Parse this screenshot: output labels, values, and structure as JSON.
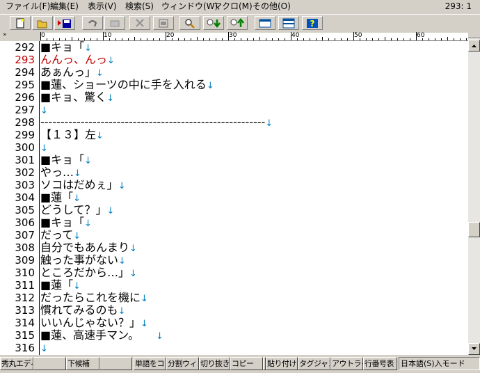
{
  "menu": {
    "items": [
      "ファイル(F)",
      "編集(E)",
      "表示(V)",
      "検索(S)",
      "ウィンドウ(W)",
      "マクロ(M)",
      "その他(O)"
    ],
    "cursor_position": "293: 1"
  },
  "toolbar": {
    "buttons": [
      "new-file",
      "open-file",
      "save-file",
      "undo",
      "redo",
      "cut",
      "paste",
      "find",
      "find-next",
      "find-previous",
      "window",
      "split",
      "help"
    ]
  },
  "ruler": {
    "marks": [
      "0",
      "10",
      "20",
      "30",
      "40",
      "50",
      "60"
    ]
  },
  "editor": {
    "current_line": 293,
    "lines": [
      {
        "num": "292",
        "text": "■キョ「"
      },
      {
        "num": "293",
        "text": "んんっ、んっ"
      },
      {
        "num": "294",
        "text": "あぁんっ」"
      },
      {
        "num": "295",
        "text": "■蓮、ショーツの中に手を入れる"
      },
      {
        "num": "296",
        "text": "■キョ、驚く"
      },
      {
        "num": "297",
        "text": ""
      },
      {
        "num": "298",
        "text": "--------------------------------------------------------"
      },
      {
        "num": "299",
        "text": "【１３】左"
      },
      {
        "num": "300",
        "text": ""
      },
      {
        "num": "301",
        "text": "■キョ「"
      },
      {
        "num": "302",
        "text": "やっ…"
      },
      {
        "num": "303",
        "text": "ソコはだめぇ」"
      },
      {
        "num": "304",
        "text": "■蓮「"
      },
      {
        "num": "305",
        "text": "どうして？」"
      },
      {
        "num": "306",
        "text": "■キョ「"
      },
      {
        "num": "307",
        "text": "だって"
      },
      {
        "num": "308",
        "text": "自分でもあんまり"
      },
      {
        "num": "309",
        "text": "触った事がない"
      },
      {
        "num": "310",
        "text": "ところだから…」"
      },
      {
        "num": "311",
        "text": "■蓮「"
      },
      {
        "num": "312",
        "text": "だったらこれを機に"
      },
      {
        "num": "313",
        "text": "慣れてみるのも"
      },
      {
        "num": "314",
        "text": "いいんじゃない？」"
      },
      {
        "num": "315",
        "text": "■蓮、高速手マン。　　"
      },
      {
        "num": "316",
        "text": ""
      }
    ],
    "newline_mark": "↓"
  },
  "function_keys": {
    "labels": [
      "秀丸エディ",
      "",
      "下候補",
      "",
      "単語をコ",
      "分割ウィン",
      "切り抜き",
      "コピー",
      "",
      "貼り付け",
      "タグジャンプ",
      "アウトライン",
      "行番号表"
    ],
    "ime_mode": "日本語(S)入モード"
  }
}
